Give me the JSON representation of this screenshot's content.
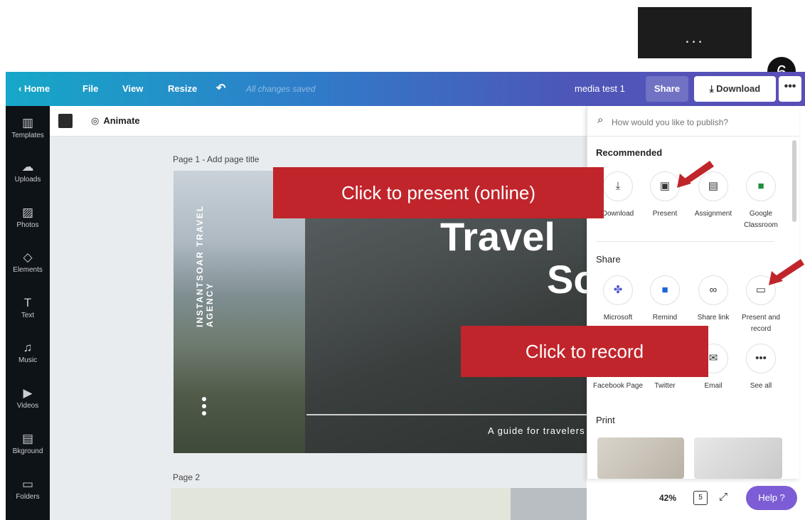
{
  "annotation": {
    "menu_dots": "...",
    "step_number": "6"
  },
  "topbar": {
    "home": "‹ Home",
    "file": "File",
    "view": "View",
    "resize": "Resize",
    "undo_glyph": "↶",
    "status": "All changes saved",
    "doc_name": "media test 1",
    "share": "Share",
    "download": "⤓ Download",
    "more": "•••"
  },
  "sidebar": {
    "items": [
      {
        "icon": "▥",
        "label": "Templates"
      },
      {
        "icon": "☁",
        "label": "Uploads"
      },
      {
        "icon": "▨",
        "label": "Photos"
      },
      {
        "icon": "◇",
        "label": "Elements"
      },
      {
        "icon": "T",
        "label": "Text"
      },
      {
        "icon": "♫",
        "label": "Music"
      },
      {
        "icon": "▶",
        "label": "Videos"
      },
      {
        "icon": "▤",
        "label": "Bkground"
      },
      {
        "icon": "▭",
        "label": "Folders"
      }
    ]
  },
  "toolbar": {
    "animate": "Animate",
    "animate_icon": "◎"
  },
  "canvas": {
    "page1_title": "Page 1 - Add page title",
    "vertical_text": "INSTANTSOAR TRAVEL AGENCY",
    "title_line1": "Travel",
    "title_line2": "So",
    "subtitle": "A guide for travelers",
    "page2_title": "Page 2"
  },
  "panel": {
    "search_placeholder": "How would you like to publish?",
    "recommended_heading": "Recommended",
    "share_heading": "Share",
    "print_heading": "Print",
    "recommended": [
      {
        "icon": "⤓",
        "label": "Download"
      },
      {
        "icon": "▣",
        "label": "Present"
      },
      {
        "icon": "▤",
        "label": "Assignment"
      },
      {
        "icon": "■",
        "label": "Google Classroom"
      }
    ],
    "share_row1": [
      {
        "icon": "✤",
        "label": "Microsoft"
      },
      {
        "icon": "■",
        "label": "Remind"
      },
      {
        "icon": "∞",
        "label": "Share link"
      },
      {
        "icon": "▭",
        "label": "Present and record"
      }
    ],
    "share_row2": [
      {
        "icon": "f",
        "label": "Facebook Page"
      },
      {
        "icon": "t",
        "label": "Twitter"
      },
      {
        "icon": "✉",
        "label": "Email"
      },
      {
        "icon": "•••",
        "label": "See all"
      }
    ]
  },
  "bottom": {
    "zoom": "42%",
    "page_count": "5",
    "fullscreen": "⤢",
    "help": "Help ?"
  },
  "callouts": {
    "present": "Click to present (online)",
    "record": "Click to record"
  },
  "colors": {
    "callout_red": "#c0252b",
    "arrow_red": "#c0252b",
    "help_purple": "#7c5dd6"
  }
}
